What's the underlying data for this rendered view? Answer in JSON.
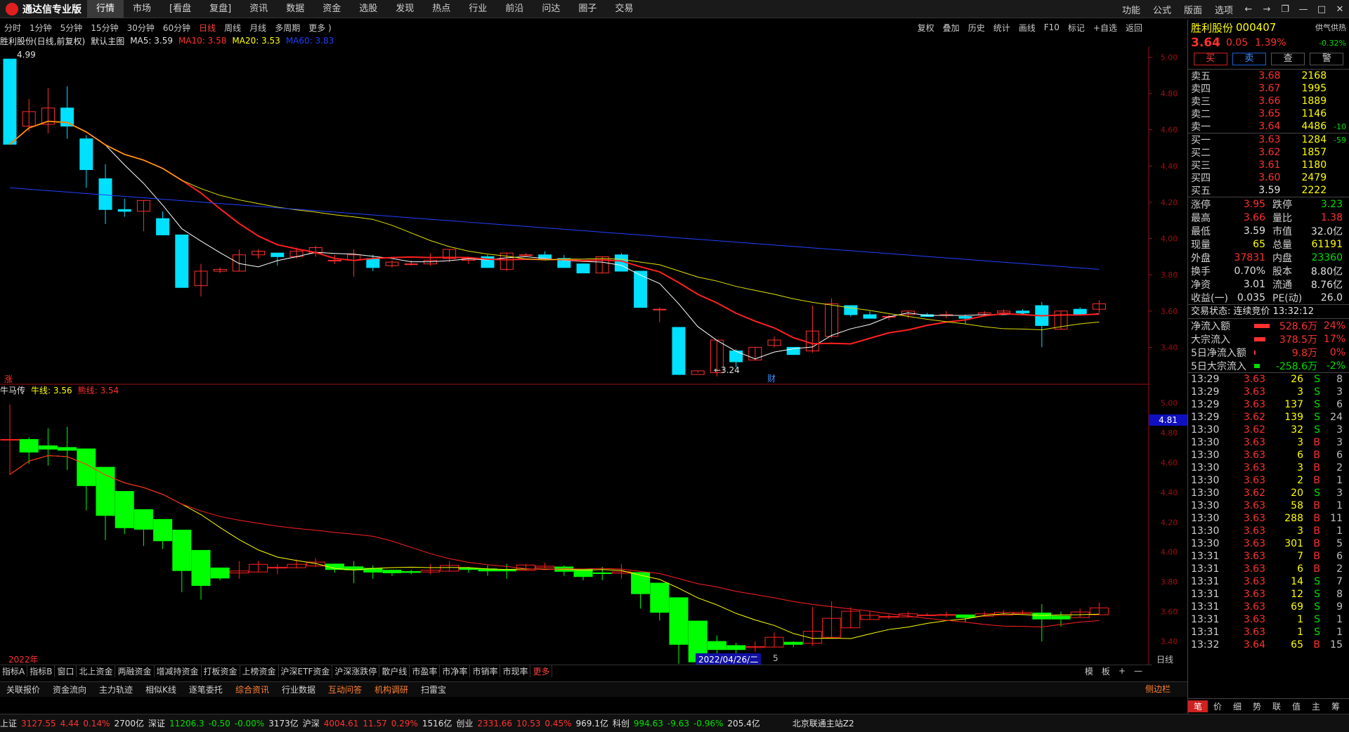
{
  "app": {
    "title": "通达信专业版"
  },
  "menu": [
    "行情",
    "市场",
    "[看盘",
    "复盘]",
    "资讯",
    "数据",
    "资金",
    "选股",
    "发现",
    "热点",
    "行业",
    "前沿",
    "问达",
    "圈子",
    "交易"
  ],
  "menu_active": 0,
  "topright": [
    "功能",
    "公式",
    "版面",
    "选项"
  ],
  "window_buttons": [
    "←",
    "→",
    "❐",
    "—",
    "□",
    "✕"
  ],
  "periods": [
    "分时",
    "1分钟",
    "5分钟",
    "15分钟",
    "30分钟",
    "60分钟",
    "日线",
    "周线",
    "月线",
    "多周期",
    "更多 )"
  ],
  "period_active": 6,
  "tools": [
    "复权",
    "叠加",
    "历史",
    "统计",
    "画线",
    "F10",
    "标记",
    "+自选",
    "返回"
  ],
  "main_legend": {
    "name": "胜利股份(日线,前复权)",
    "template": "默认主图",
    "ma5": "MA5: 3.59",
    "ma10": "MA10: 3.58",
    "ma20": "MA20: 3.53",
    "ma60": "MA60: 3.83"
  },
  "sub_legend": {
    "name": "牛马传",
    "bull": "牛线: 3.56",
    "bear": "熊线: 3.54"
  },
  "chart_labels": {
    "high_marker": "4.99",
    "low_marker": "←3.24",
    "cai": "财",
    "zhang": "涨",
    "price_tag": "4.81",
    "date_2022": "2022年",
    "date_cursor": "2022/04/26/二",
    "date_5": "5",
    "period_label": "日线"
  },
  "price_axis_main": [
    "5.00",
    "4.80",
    "4.60",
    "4.40",
    "4.20",
    "4.00",
    "3.80",
    "3.60",
    "3.40"
  ],
  "price_axis_sub": [
    "5.00",
    "4.80",
    "4.60",
    "4.40",
    "4.20",
    "4.00",
    "3.80",
    "3.60",
    "3.40"
  ],
  "chart_data": {
    "type": "candlestick",
    "series": [
      {
        "name": "K",
        "ohlc": [
          [
            4.99,
            4.99,
            4.52,
            4.52
          ],
          [
            4.62,
            4.77,
            4.59,
            4.7
          ],
          [
            4.63,
            4.83,
            4.58,
            4.72
          ],
          [
            4.72,
            4.84,
            4.55,
            4.62
          ],
          [
            4.55,
            4.57,
            4.28,
            4.38
          ],
          [
            4.33,
            4.41,
            4.08,
            4.16
          ],
          [
            4.16,
            4.22,
            4.12,
            4.15
          ],
          [
            4.15,
            4.21,
            4.04,
            4.21
          ],
          [
            4.11,
            4.15,
            4.02,
            4.02
          ],
          [
            4.02,
            4.02,
            3.73,
            3.73
          ],
          [
            3.74,
            3.86,
            3.68,
            3.82
          ],
          [
            3.82,
            3.84,
            3.81,
            3.83
          ],
          [
            3.82,
            3.94,
            3.82,
            3.91
          ],
          [
            3.91,
            3.94,
            3.89,
            3.93
          ],
          [
            3.92,
            3.92,
            3.85,
            3.9
          ],
          [
            3.9,
            3.95,
            3.89,
            3.93
          ],
          [
            3.92,
            3.96,
            3.9,
            3.95
          ],
          [
            3.88,
            3.91,
            3.86,
            3.88
          ],
          [
            3.88,
            3.94,
            3.79,
            3.91
          ],
          [
            3.89,
            3.91,
            3.82,
            3.84
          ],
          [
            3.85,
            3.88,
            3.84,
            3.87
          ],
          [
            3.86,
            3.88,
            3.85,
            3.86
          ],
          [
            3.86,
            3.92,
            3.85,
            3.88
          ],
          [
            3.89,
            3.94,
            3.87,
            3.94
          ],
          [
            3.88,
            3.9,
            3.86,
            3.89
          ],
          [
            3.9,
            3.91,
            3.84,
            3.84
          ],
          [
            3.83,
            3.92,
            3.82,
            3.92
          ],
          [
            3.91,
            3.92,
            3.91,
            3.91
          ],
          [
            3.91,
            3.93,
            3.89,
            3.89
          ],
          [
            3.89,
            3.91,
            3.84,
            3.84
          ],
          [
            3.86,
            3.86,
            3.81,
            3.81
          ],
          [
            3.81,
            3.9,
            3.81,
            3.9
          ],
          [
            3.91,
            3.92,
            3.82,
            3.82
          ],
          [
            3.82,
            3.82,
            3.62,
            3.62
          ],
          [
            3.61,
            3.62,
            3.54,
            3.61
          ],
          [
            3.51,
            3.51,
            3.25,
            3.25
          ],
          [
            3.25,
            3.27,
            3.26,
            3.27
          ],
          [
            3.26,
            3.44,
            3.24,
            3.44
          ],
          [
            3.38,
            3.39,
            3.29,
            3.32
          ],
          [
            3.33,
            3.4,
            3.33,
            3.4
          ],
          [
            3.41,
            3.46,
            3.4,
            3.44
          ],
          [
            3.4,
            3.4,
            3.36,
            3.36
          ],
          [
            3.38,
            3.63,
            3.37,
            3.49
          ],
          [
            3.46,
            3.67,
            3.45,
            3.64
          ],
          [
            3.63,
            3.63,
            3.57,
            3.58
          ],
          [
            3.58,
            3.6,
            3.56,
            3.56
          ],
          [
            3.57,
            3.58,
            3.55,
            3.57
          ],
          [
            3.58,
            3.6,
            3.56,
            3.6
          ],
          [
            3.58,
            3.59,
            3.57,
            3.57
          ],
          [
            3.58,
            3.6,
            3.56,
            3.58
          ],
          [
            3.57,
            3.58,
            3.53,
            3.56
          ],
          [
            3.58,
            3.6,
            3.57,
            3.59
          ],
          [
            3.59,
            3.61,
            3.58,
            3.6
          ],
          [
            3.6,
            3.61,
            3.58,
            3.59
          ],
          [
            3.63,
            3.65,
            3.4,
            3.52
          ],
          [
            3.5,
            3.6,
            3.5,
            3.6
          ],
          [
            3.61,
            3.62,
            3.58,
            3.58
          ],
          [
            3.61,
            3.66,
            3.59,
            3.64
          ]
        ]
      }
    ]
  },
  "quote": {
    "name": "胜利股份",
    "code": "000407",
    "badge": "供气供热",
    "price": "3.64",
    "change": "0.05",
    "pct": "1.39%",
    "badge_pct": "-0.32%",
    "buttons": [
      "买",
      "卖",
      "查",
      "警"
    ]
  },
  "asks": [
    {
      "label": "卖五",
      "price": "3.68",
      "vol": "2168",
      "chg": ""
    },
    {
      "label": "卖四",
      "price": "3.67",
      "vol": "1995",
      "chg": ""
    },
    {
      "label": "卖三",
      "price": "3.66",
      "vol": "1889",
      "chg": ""
    },
    {
      "label": "卖二",
      "price": "3.65",
      "vol": "1146",
      "chg": ""
    },
    {
      "label": "卖一",
      "price": "3.64",
      "vol": "4486",
      "chg": "-10"
    }
  ],
  "bids": [
    {
      "label": "买一",
      "price": "3.63",
      "vol": "1284",
      "chg": "-59"
    },
    {
      "label": "买二",
      "price": "3.62",
      "vol": "1857",
      "chg": ""
    },
    {
      "label": "买三",
      "price": "3.61",
      "vol": "1180",
      "chg": ""
    },
    {
      "label": "买四",
      "price": "3.60",
      "vol": "2479",
      "chg": ""
    },
    {
      "label": "买五",
      "price": "3.59",
      "vol": "2222",
      "chg": ""
    }
  ],
  "stats": [
    {
      "l": "涨停",
      "v": "3.95",
      "vc": "red",
      "l2": "跌停",
      "v2": "3.23",
      "v2c": "green"
    },
    {
      "l": "最高",
      "v": "3.66",
      "vc": "red",
      "l2": "量比",
      "v2": "1.38",
      "v2c": "red"
    },
    {
      "l": "最低",
      "v": "3.59",
      "vc": "white",
      "l2": "市值",
      "v2": "32.0亿",
      "v2c": "white"
    },
    {
      "l": "现量",
      "v": "65",
      "vc": "yellow",
      "l2": "总量",
      "v2": "61191",
      "v2c": "yellow"
    },
    {
      "l": "外盘",
      "v": "37831",
      "vc": "red",
      "l2": "内盘",
      "v2": "23360",
      "v2c": "green"
    },
    {
      "l": "换手",
      "v": "0.70%",
      "vc": "white",
      "l2": "股本",
      "v2": "8.80亿",
      "v2c": "white"
    },
    {
      "l": "净资",
      "v": "3.01",
      "vc": "white",
      "l2": "流通",
      "v2": "8.76亿",
      "v2c": "white"
    },
    {
      "l": "收益(一)",
      "v": "0.035",
      "vc": "white",
      "l2": "PE(动)",
      "v2": "26.0",
      "v2c": "white"
    }
  ],
  "trade_status": "交易状态: 连续竞价 13:32:12",
  "flows": [
    {
      "l": "净流入额",
      "bar": 0.9,
      "barc": "red",
      "v": "528.6万",
      "p": "24%",
      "c": "red"
    },
    {
      "l": "大宗流入",
      "bar": 0.65,
      "barc": "red",
      "v": "378.5万",
      "p": "17%",
      "c": "red"
    },
    {
      "l": "5日净流入额",
      "bar": 0.05,
      "barc": "red",
      "v": "9.8万",
      "p": "0%",
      "c": "red"
    },
    {
      "l": "5日大宗流入",
      "bar": 0.35,
      "barc": "green",
      "v": "-258.6万",
      "p": "-2%",
      "c": "green"
    }
  ],
  "ticks": [
    {
      "t": "13:29",
      "p": "3.63",
      "v": "26",
      "bs": "S",
      "n": "8"
    },
    {
      "t": "13:29",
      "p": "3.63",
      "v": "3",
      "bs": "S",
      "n": "3"
    },
    {
      "t": "13:29",
      "p": "3.63",
      "v": "137",
      "bs": "S",
      "n": "6"
    },
    {
      "t": "13:29",
      "p": "3.62",
      "v": "139",
      "bs": "S",
      "n": "24"
    },
    {
      "t": "13:30",
      "p": "3.62",
      "v": "32",
      "bs": "S",
      "n": "3"
    },
    {
      "t": "13:30",
      "p": "3.63",
      "v": "3",
      "bs": "B",
      "n": "3"
    },
    {
      "t": "13:30",
      "p": "3.63",
      "v": "6",
      "bs": "B",
      "n": "6"
    },
    {
      "t": "13:30",
      "p": "3.63",
      "v": "3",
      "bs": "B",
      "n": "2"
    },
    {
      "t": "13:30",
      "p": "3.63",
      "v": "2",
      "bs": "B",
      "n": "1"
    },
    {
      "t": "13:30",
      "p": "3.62",
      "v": "20",
      "bs": "S",
      "n": "3"
    },
    {
      "t": "13:30",
      "p": "3.63",
      "v": "58",
      "bs": "B",
      "n": "1"
    },
    {
      "t": "13:30",
      "p": "3.63",
      "v": "288",
      "bs": "B",
      "n": "11"
    },
    {
      "t": "13:30",
      "p": "3.63",
      "v": "3",
      "bs": "B",
      "n": "1"
    },
    {
      "t": "13:30",
      "p": "3.63",
      "v": "301",
      "bs": "B",
      "n": "5"
    },
    {
      "t": "13:31",
      "p": "3.63",
      "v": "7",
      "bs": "B",
      "n": "6"
    },
    {
      "t": "13:31",
      "p": "3.63",
      "v": "6",
      "bs": "B",
      "n": "2"
    },
    {
      "t": "13:31",
      "p": "3.63",
      "v": "14",
      "bs": "S",
      "n": "7"
    },
    {
      "t": "13:31",
      "p": "3.63",
      "v": "12",
      "bs": "S",
      "n": "8"
    },
    {
      "t": "13:31",
      "p": "3.63",
      "v": "69",
      "bs": "S",
      "n": "9"
    },
    {
      "t": "13:31",
      "p": "3.63",
      "v": "1",
      "bs": "S",
      "n": "1"
    },
    {
      "t": "13:31",
      "p": "3.63",
      "v": "1",
      "bs": "S",
      "n": "1"
    },
    {
      "t": "13:32",
      "p": "3.64",
      "v": "65",
      "bs": "B",
      "n": "15"
    }
  ],
  "right_tabs": [
    "笔",
    "价",
    "细",
    "势",
    "联",
    "值",
    "主",
    "筹"
  ],
  "indicator_tabs": [
    "指标A",
    "指标B",
    "窗口",
    "北上资金",
    "两融资金",
    "增减持资金",
    "打板资金",
    "上榜资金",
    "沪深ETF资金",
    "沪深涨跌停",
    "散户线",
    "市盈率",
    "市净率",
    "市销率",
    "市现率",
    "更多"
  ],
  "indicator_right": [
    "模",
    "板",
    "+",
    "—"
  ],
  "bottom_tabs": [
    "关联报价",
    "资金流向",
    "主力轨迹",
    "相似K线",
    "逐笔委托",
    "综合资讯",
    "行业数据",
    "互动问答",
    "机构调研",
    "扫雷宝"
  ],
  "bottom_right": "侧边栏",
  "status": {
    "sh": [
      "上证",
      "3127.55",
      "4.44",
      "0.14%",
      "2700亿"
    ],
    "sz": [
      "深证",
      "11206.3",
      "-0.50",
      "-0.00%",
      "3173亿"
    ],
    "hs": [
      "沪深",
      "4004.61",
      "11.57",
      "0.29%",
      "1516亿"
    ],
    "cy": [
      "创业",
      "2331.66",
      "10.53",
      "0.45%",
      "969.1亿"
    ],
    "kc": [
      "科创",
      "994.63",
      "-9.63",
      "-0.96%",
      "205.4亿"
    ],
    "server": "北京联通主站Z2"
  },
  "colors": {
    "up": "#ff3030",
    "down": "#00e0ff",
    "ma5": "#ffffff",
    "ma10": "#ff2020",
    "ma20": "#e0e000",
    "ma60": "#2040ff",
    "sub_up": "#ff2020",
    "sub_down": "#00ff00"
  }
}
